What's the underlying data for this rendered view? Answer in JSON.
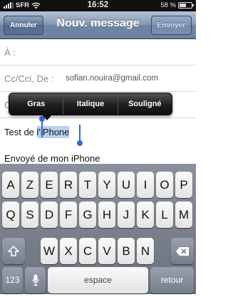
{
  "status_bar": {
    "carrier": "SFR",
    "time": "16:52",
    "battery": "58 %",
    "battery_level": 0.58
  },
  "nav": {
    "cancel_label": "Annuler",
    "title": "Nouv. message",
    "send_label": "Envoyer"
  },
  "fields": {
    "to_label": "À :",
    "cc_label": "Cc/Cci, De :",
    "cc_value": "sofian.nouira@gmail.com",
    "subject_label": "O"
  },
  "edit_menu": {
    "items": [
      "Gras",
      "Italique",
      "Souligné"
    ]
  },
  "body": {
    "text_before_selection": "Test de ",
    "selected_text": "l'iPhone",
    "signature": "Envoyé de mon iPhone"
  },
  "keyboard": {
    "row1": [
      "A",
      "Z",
      "E",
      "R",
      "T",
      "Y",
      "U",
      "I",
      "O",
      "P"
    ],
    "row2": [
      "Q",
      "S",
      "D",
      "F",
      "G",
      "H",
      "J",
      "K",
      "L",
      "M"
    ],
    "row3": [
      "W",
      "X",
      "C",
      "V",
      "B",
      "N"
    ],
    "numbers_label": "123",
    "space_label": "espace",
    "return_label": "retour",
    "icons": [
      "shift-icon",
      "backspace-icon",
      "microphone-icon"
    ]
  }
}
